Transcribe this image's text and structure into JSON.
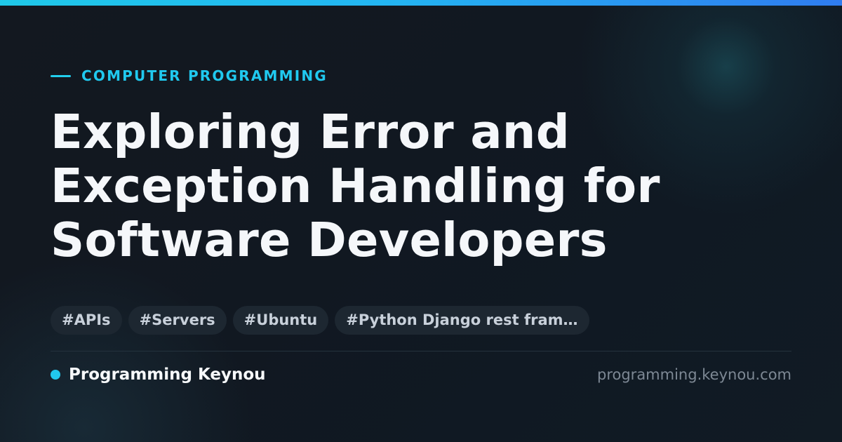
{
  "category": "COMPUTER PROGRAMMING",
  "title": {
    "line1": "Exploring Error and",
    "line2": "Exception Handling for",
    "line3": "Software Developers"
  },
  "tags": [
    "#APIs",
    "#Servers",
    "#Ubuntu",
    "#Python Django rest fram…"
  ],
  "brand": {
    "name": "Programming Keynou",
    "domain": "programming.keynou.com"
  },
  "colors": {
    "accent": "#21c9ee",
    "background": "#111820",
    "title": "#f5f7fa",
    "tag_background": "#1d2731",
    "muted": "#7d8894"
  }
}
